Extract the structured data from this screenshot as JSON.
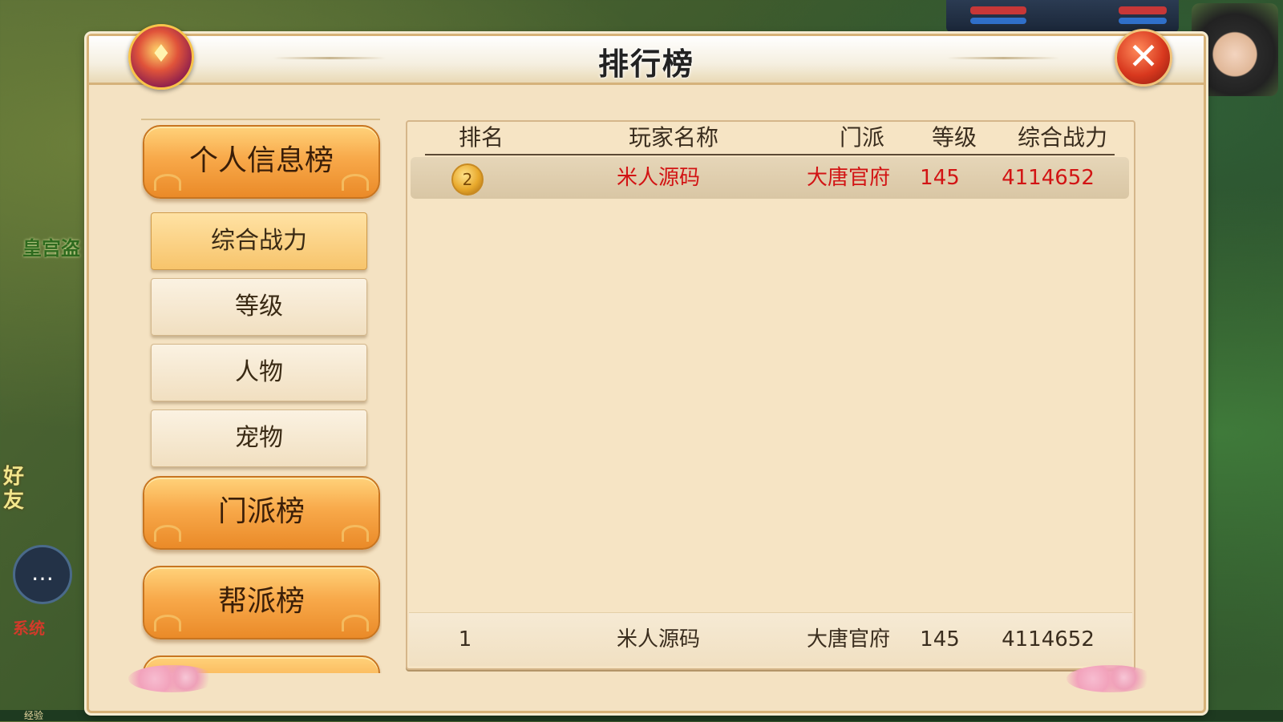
{
  "window": {
    "title": "排行榜",
    "close_icon": "✕",
    "badge_icon": "♦"
  },
  "background": {
    "friend_label": "好友",
    "npc_label": "皇宫盗",
    "system_label": "系统",
    "exp_label": "经验",
    "chat_icon": "…"
  },
  "categories": {
    "personal": "个人信息榜",
    "sect": "门派榜",
    "guild": "帮派榜"
  },
  "subcategories": [
    {
      "label": "综合战力",
      "active": true
    },
    {
      "label": "等级",
      "active": false
    },
    {
      "label": "人物",
      "active": false
    },
    {
      "label": "宠物",
      "active": false
    }
  ],
  "table": {
    "headers": {
      "rank": "排名",
      "name": "玩家名称",
      "sect": "门派",
      "level": "等级",
      "power": "综合战力"
    },
    "rows": [
      {
        "rank_icon": "2",
        "name": "米人源码",
        "sect": "大唐官府",
        "level": "145",
        "power": "4114652"
      }
    ],
    "self_row": {
      "rank": "1",
      "name": "米人源码",
      "sect": "大唐官府",
      "level": "145",
      "power": "4114652"
    }
  },
  "colors": {
    "row_text": "#d21414",
    "header_text": "#3a2d1e",
    "button_orange": "#f8a94a"
  }
}
